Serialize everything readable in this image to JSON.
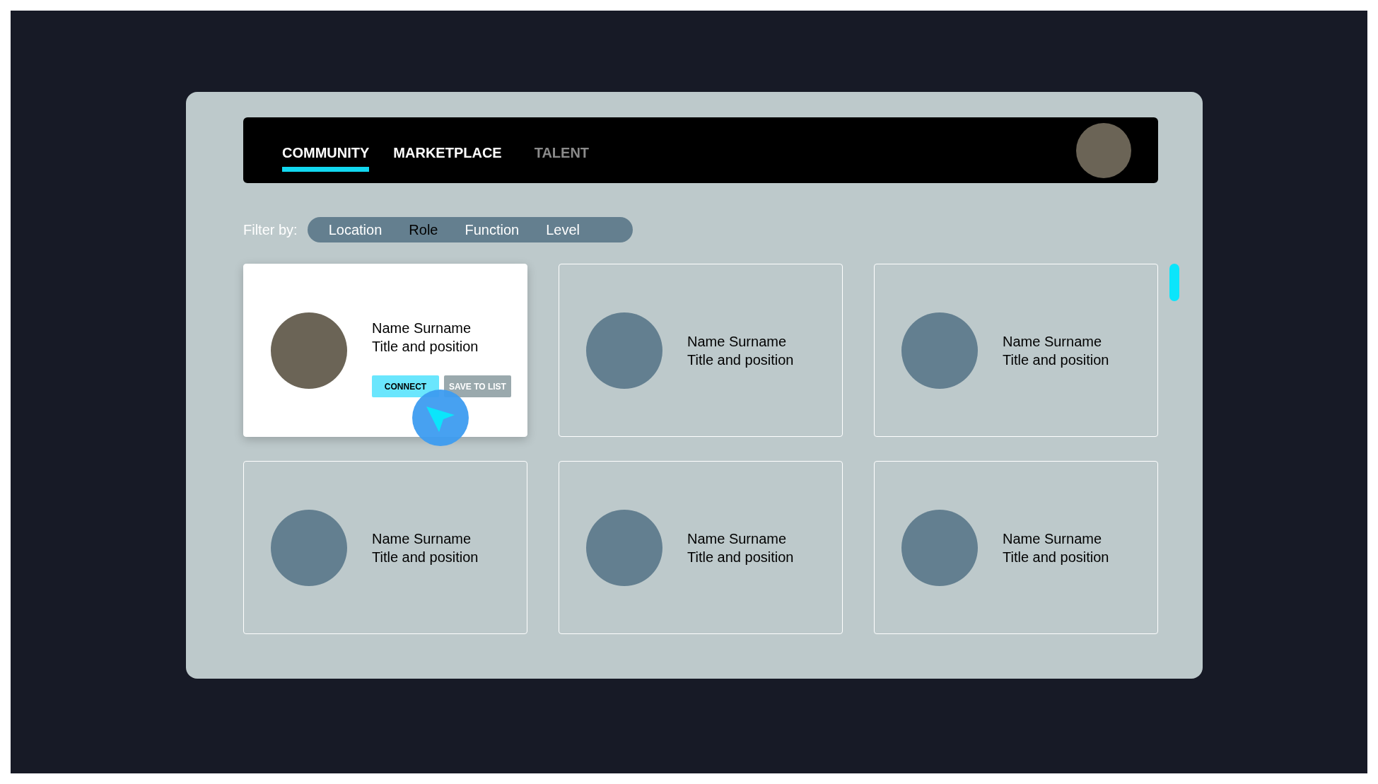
{
  "nav": {
    "tabs": [
      {
        "label": "COMMUNITY",
        "selected": true,
        "disabled": false
      },
      {
        "label": "MARKETPLACE",
        "selected": false,
        "disabled": false
      },
      {
        "label": "TALENT",
        "selected": false,
        "disabled": true
      }
    ]
  },
  "filter": {
    "label": "Filter by:",
    "options": [
      {
        "label": "Location",
        "selected": false
      },
      {
        "label": "Role",
        "selected": true
      },
      {
        "label": "Function",
        "selected": false
      },
      {
        "label": "Level",
        "selected": false
      }
    ]
  },
  "cards": [
    {
      "name": "Name Surname",
      "title": "Title and position",
      "highlighted": true,
      "buttons": [
        {
          "label": "CONNECT",
          "kind": "primary"
        },
        {
          "label": "SAVE TO LIST",
          "kind": "secondary"
        }
      ]
    },
    {
      "name": "Name Surname",
      "title": "Title and position",
      "highlighted": false
    },
    {
      "name": "Name Surname",
      "title": "Title and position",
      "highlighted": false
    },
    {
      "name": "Name Surname",
      "title": "Title and position",
      "highlighted": false
    },
    {
      "name": "Name Surname",
      "title": "Title and position",
      "highlighted": false
    },
    {
      "name": "Name Surname",
      "title": "Title and position",
      "highlighted": false
    }
  ]
}
